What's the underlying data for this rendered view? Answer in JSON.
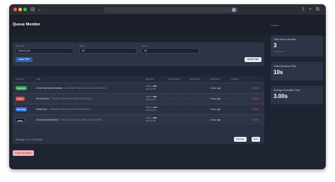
{
  "app": {
    "title": "Queue Monitor"
  },
  "browser": {
    "url": ""
  },
  "filters": {
    "fields": [
      {
        "label": "Job name",
        "value": "Search job"
      },
      {
        "label": "Status",
        "value": "All"
      },
      {
        "label": "Queue",
        "value": "All"
      }
    ],
    "apply_label": "Apply Filter",
    "reset_label": "Reset Filter"
  },
  "table": {
    "headers": [
      "Status",
      "Job",
      "Details",
      "Progress",
      "Duration",
      "Started",
      "Queue",
      ""
    ],
    "rows": [
      {
        "status": "Success",
        "status_color": "#2f9e5a",
        "status_text_color": "#ffffff",
        "job_class": "CheckFailedAuthentication",
        "job_uuid": "a1c4e9d2-7b3f-4a6e-9f21-3e8d5c7b2a10",
        "detail_key1": "Status:",
        "detail_val1": "with",
        "detail_key2": "Attempt:",
        "detail_val2": "1",
        "progress": "-",
        "duration": "-",
        "started": "1 hour ago",
        "queue": "-",
        "delete_label": "Delete"
      },
      {
        "status": "Failed",
        "status_color": "#d64545",
        "status_text_color": "#ffffff",
        "job_class": "RenderVideo",
        "job_uuid": "b7e2f5a1-3c9d-4e8b-a6f4-9d1c2e5b8a37",
        "detail_key1": "Status:",
        "detail_val1": "with",
        "detail_key2": "Attempt:",
        "detail_val2": "1",
        "progress": "-",
        "duration": "-",
        "started": "1 hour ago",
        "queue": "-",
        "delete_label": "Delete"
      },
      {
        "status": "Running",
        "status_color": "#3a6fd8",
        "status_text_color": "#ffffff",
        "job_class": "DeleteUser",
        "job_uuid": "c3d8a6f2-9e4b-4b1a-8c7d-2f5e9a3b6c41",
        "detail_key1": "Status:",
        "detail_val1": "user",
        "detail_key2": "Attempt:",
        "detail_val2": "1",
        "progress": "-",
        "duration": "-",
        "started": "1 hour ago",
        "queue": "-",
        "delete_label": "Delete"
      },
      {
        "status": "Stale",
        "status_color": "#0f1117",
        "status_text_color": "#ffffff",
        "job_class": "SendConfirmationMail",
        "job_uuid": "d9f1b4c7-2a6e-4d3b-9e8f-7c1a5d2b9e63",
        "detail_key1": "Status:",
        "detail_val1": "with",
        "detail_key2": "Attempt:",
        "detail_val2": "1",
        "progress": "-",
        "duration": "-",
        "started": "1 hour ago",
        "queue": "-",
        "delete_label": "Delete"
      }
    ],
    "showing_text": "Showing 1 to 4 of 4 results",
    "previous_label": "Previous",
    "next_label": "Next"
  },
  "delete_all_label": "Delete all entries",
  "sidebar": {
    "section_label": "Statistics",
    "stats": [
      {
        "title": "Total Jobs Executed",
        "value": "3",
        "sub": "Up Trend: 0"
      },
      {
        "title": "Total Execution Time",
        "value": "10s",
        "sub": ""
      },
      {
        "title": "Average Execution Time",
        "value": "3.00s",
        "sub": ""
      }
    ]
  },
  "colors": {
    "accent": "#2a5fb8",
    "background": "#1f2432",
    "panel": "#2d3446",
    "danger": "#e05a5a",
    "success": "#3fbf6b"
  }
}
